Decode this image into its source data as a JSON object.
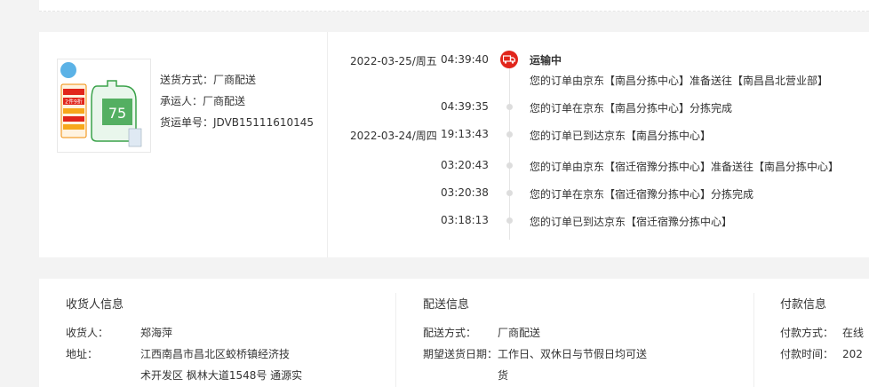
{
  "shipping": {
    "method_label": "送货方式：",
    "method": "厂商配送",
    "carrier_label": "承运人：",
    "carrier": "厂商配送",
    "waybill_label": "货运单号：",
    "waybill": "JDVB15111610145"
  },
  "timeline": {
    "status": "运输中",
    "events": [
      {
        "date": "2022-03-25/周五",
        "time": "04:39:40",
        "text": "您的订单由京东【南昌分拣中心】准备送往【南昌昌北营业部】"
      },
      {
        "date": "",
        "time": "04:39:35",
        "text": "您的订单在京东【南昌分拣中心】分拣完成"
      },
      {
        "date": "2022-03-24/周四",
        "time": "19:13:43",
        "text": "您的订单已到达京东【南昌分拣中心】"
      },
      {
        "date": "",
        "time": "03:20:43",
        "text": "您的订单由京东【宿迁宿豫分拣中心】准备送往【南昌分拣中心】"
      },
      {
        "date": "",
        "time": "03:20:38",
        "text": "您的订单在京东【宿迁宿豫分拣中心】分拣完成"
      },
      {
        "date": "",
        "time": "03:18:13",
        "text": "您的订单已到达京东【宿迁宿豫分拣中心】"
      }
    ]
  },
  "receiver": {
    "title": "收货人信息",
    "name_label": "收货人：",
    "name": "郑海萍",
    "address_label": "地址：",
    "address_line1": "江西南昌市昌北区蛟桥镇经济技",
    "address_line2": "术开发区 枫林大道1548号 通源实"
  },
  "delivery": {
    "title": "配送信息",
    "method_label": "配送方式：",
    "method": "厂商配送",
    "date_label": "期望送货日期：",
    "date_line1": "工作日、双休日与节假日均可送",
    "date_line2": "货"
  },
  "payment": {
    "title": "付款信息",
    "method_label": "付款方式：",
    "method_partial": "在线",
    "time_label": "付款时间：",
    "time_partial": "202"
  },
  "product_image_text": {
    "badge": "2件9折",
    "number": "75"
  },
  "colors": {
    "accent_red": "#e1251b",
    "product_green": "#3aa24a"
  }
}
